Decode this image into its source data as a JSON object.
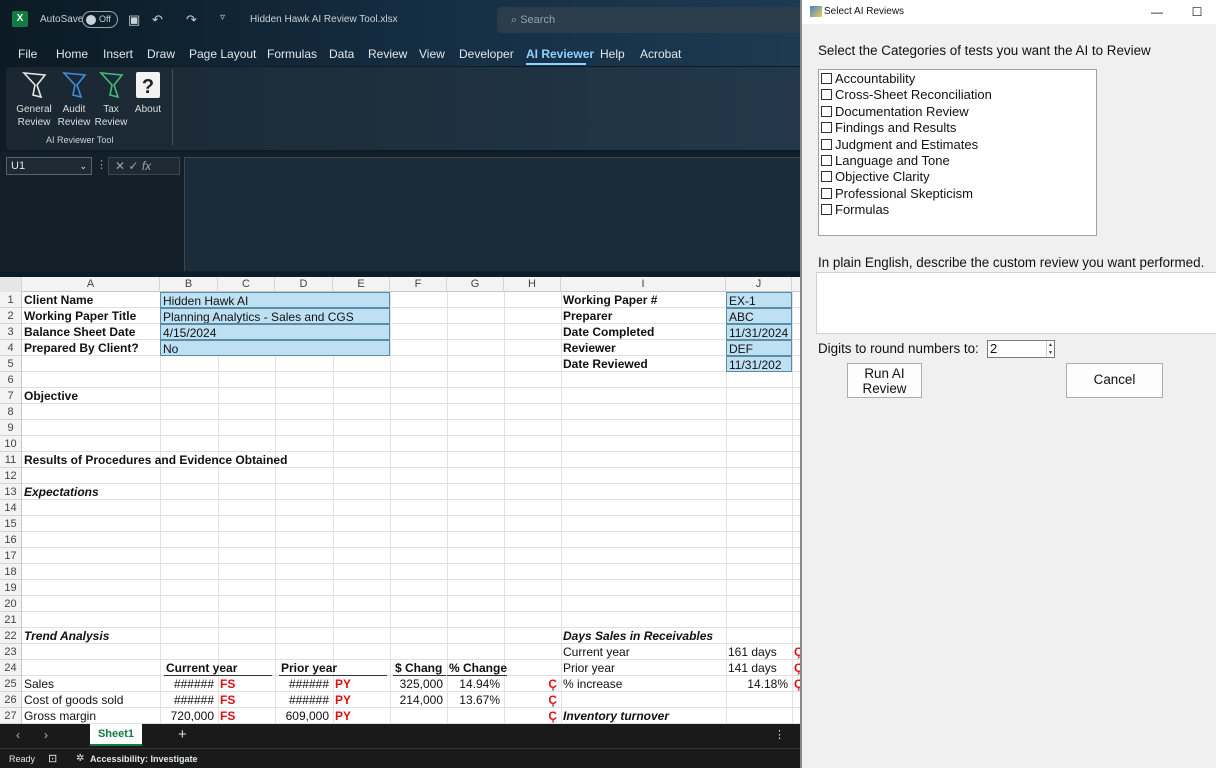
{
  "excel": {
    "autosave_label": "AutoSave",
    "autosave_state": "Off",
    "filename": "Hidden Hawk AI Review Tool.xlsx",
    "search_placeholder": "Search",
    "menu": [
      "File",
      "Home",
      "Insert",
      "Draw",
      "Page Layout",
      "Formulas",
      "Data",
      "Review",
      "View",
      "Developer",
      "AI Reviewer",
      "Help",
      "Acrobat"
    ],
    "active_menu": "AI Reviewer",
    "ribbon": {
      "buttons": [
        {
          "line1": "General",
          "line2": "Review",
          "icon": "hawk-icon"
        },
        {
          "line1": "Audit",
          "line2": "Review",
          "icon": "hawk-icon"
        },
        {
          "line1": "Tax",
          "line2": "Review",
          "icon": "hawk-icon"
        },
        {
          "line1": "About",
          "line2": "",
          "icon": "question-icon"
        }
      ],
      "group_label": "AI Reviewer Tool"
    },
    "name_box": "U1",
    "fx": "fx",
    "columns": [
      "A",
      "B",
      "C",
      "D",
      "E",
      "F",
      "G",
      "H",
      "I",
      "J"
    ],
    "rows": [
      "1",
      "2",
      "3",
      "4",
      "5",
      "6",
      "7",
      "8",
      "9",
      "10",
      "11",
      "12",
      "13",
      "14",
      "15",
      "16",
      "17",
      "18",
      "19",
      "20",
      "21",
      "22",
      "23",
      "24",
      "25",
      "26",
      "27"
    ],
    "cells": {
      "a1": "Client Name",
      "b1": "Hidden Hawk AI",
      "i1": "Working Paper #",
      "j1": "EX-1",
      "a2": "Working Paper Title",
      "b2": "Planning Analytics - Sales and CGS",
      "i2": "Preparer",
      "j2": "ABC",
      "a3": "Balance Sheet Date",
      "b3": "4/15/2024",
      "i3": "Date Completed",
      "j3": "11/31/2024",
      "a4": "Prepared By Client?",
      "b4": "No",
      "i4": "Reviewer",
      "j4": "DEF",
      "i5": "Date Reviewed",
      "j5": "11/31/202",
      "a7": "Objective",
      "a11": "Results of Procedures and Evidence Obtained",
      "a13": "Expectations",
      "a22": "Trend Analysis",
      "i22": "Days Sales in Receivables",
      "i23": "Current year",
      "j23": "161 days",
      "b24": "Current year",
      "d24": "Prior year",
      "f24": "$ Chang",
      "g24": "% Change",
      "i24": "Prior year",
      "j24": "141 days",
      "a25": "Sales",
      "b25": "######",
      "c25": "FS",
      "d25": "######",
      "e25": "PY",
      "f25": "325,000",
      "g25": "14.94%",
      "i25": "% increase",
      "j25": "14.18%",
      "a26": "Cost of goods sold",
      "b26": "######",
      "c26": "FS",
      "d26": "######",
      "e26": "PY",
      "f26": "214,000",
      "g26": "13.67%",
      "a27": "Gross margin",
      "b27": "720,000",
      "c27": "FS",
      "d27": "609,000",
      "e27": "PY",
      "i27": "Inventory turnover",
      "tick": "Ç"
    },
    "sheet_tab": "Sheet1",
    "status_ready": "Ready",
    "status_accessibility": "Accessibility: Investigate"
  },
  "dialog": {
    "title": "Select AI Reviews",
    "prompt_categories": "Select the Categories of tests you want the AI to Review",
    "categories": [
      "Accountability",
      "Cross-Sheet Reconciliation",
      "Documentation Review",
      "Findings and Results",
      "Judgment and Estimates",
      "Language and Tone",
      "Objective Clarity",
      "Professional Skepticism",
      "Formulas"
    ],
    "prompt_custom": "In plain English, describe the custom review you want performed.",
    "custom_text": "",
    "digits_label": "Digits to round numbers to:",
    "digits_value": "2",
    "run_label_1": "Run AI",
    "run_label_2": "Review",
    "cancel_label": "Cancel"
  }
}
